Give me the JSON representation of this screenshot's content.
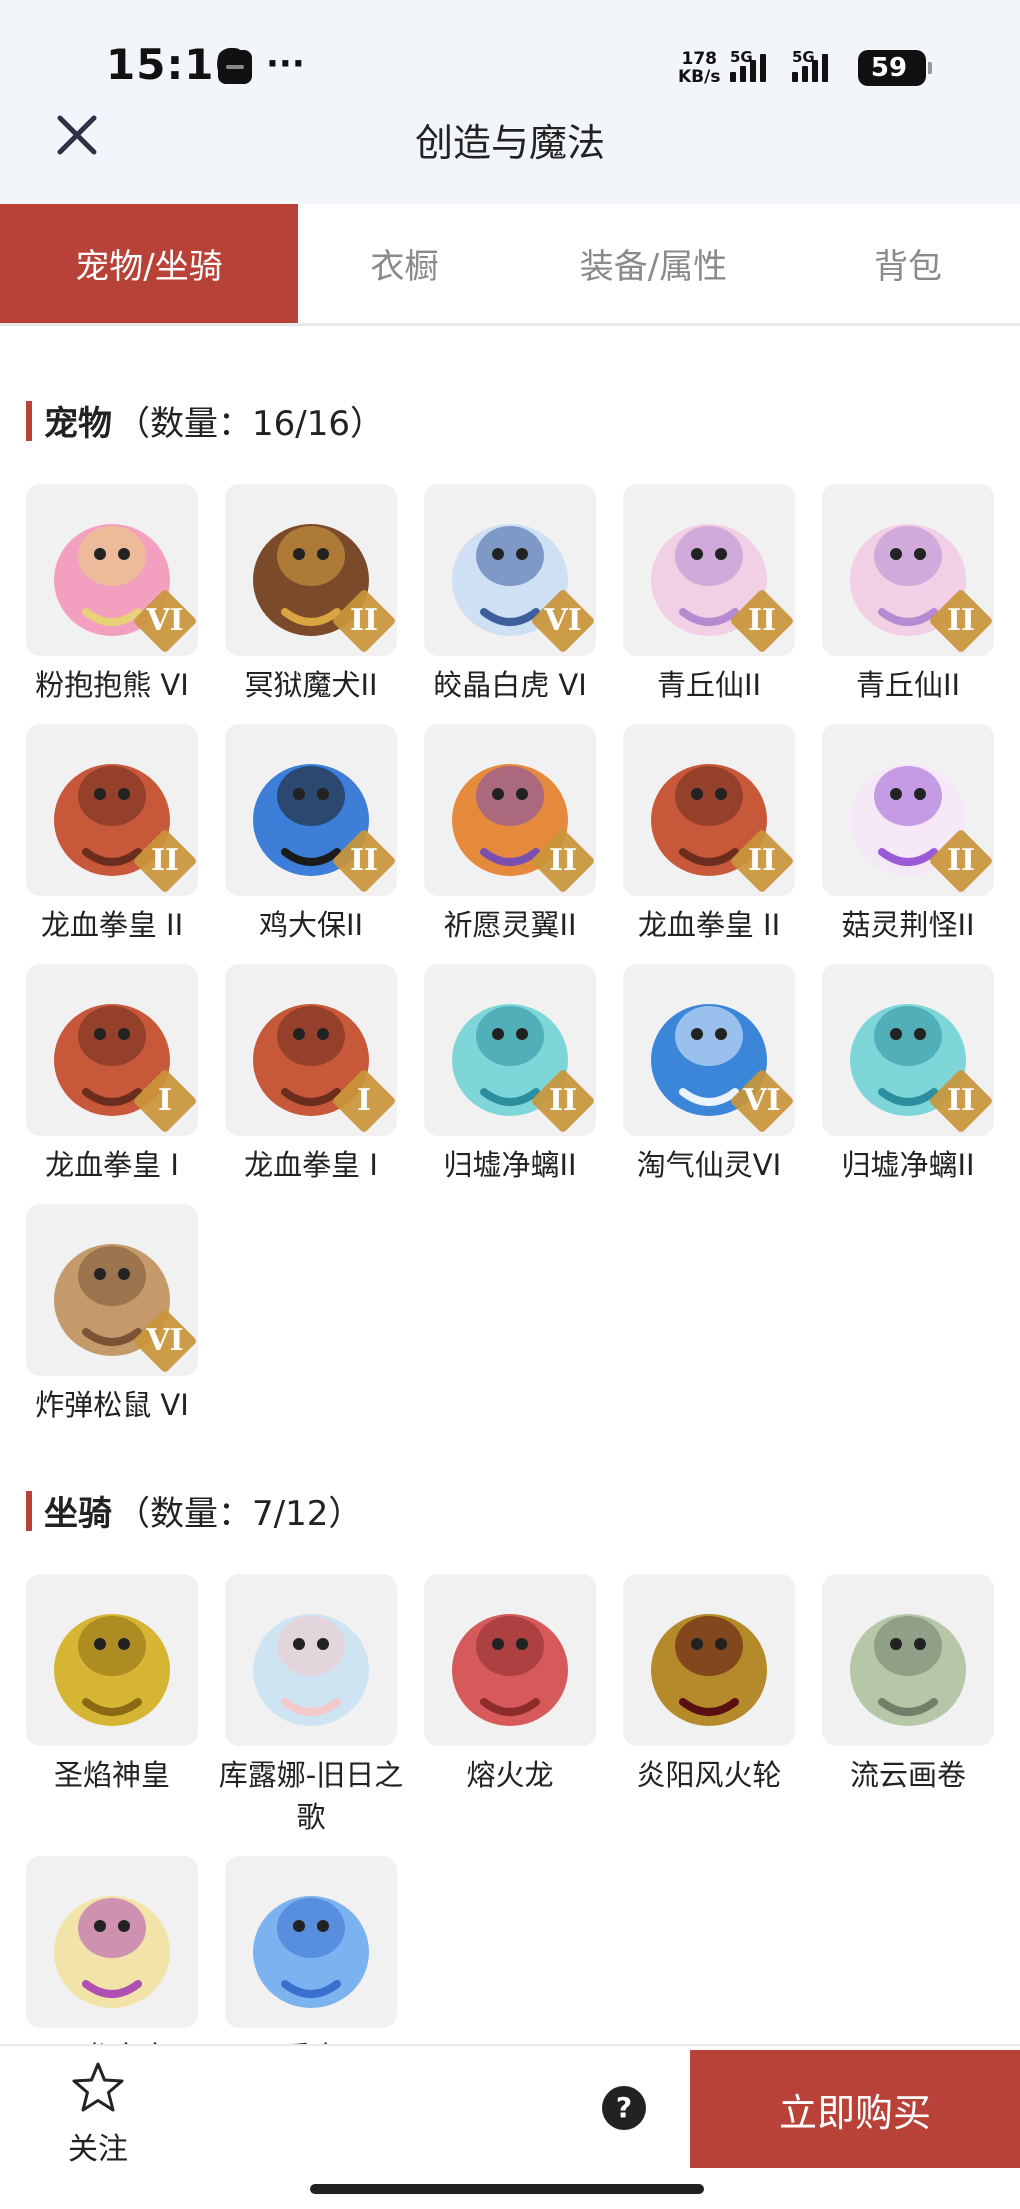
{
  "status_bar": {
    "time": "15:16",
    "net_speed_value": "178",
    "net_speed_unit": "KB/s",
    "signal_1": "5G",
    "signal_2": "5G",
    "battery": "59"
  },
  "header": {
    "title": "创造与魔法"
  },
  "tabs": [
    {
      "label": "宠物/坐骑",
      "active": true
    },
    {
      "label": "衣橱",
      "active": false
    },
    {
      "label": "装备/属性",
      "active": false
    },
    {
      "label": "背包",
      "active": false
    }
  ],
  "pets_section": {
    "title": "宠物",
    "count": "（数量：16/16）",
    "items": [
      {
        "name": "粉抱抱熊 VI",
        "icon": "pink-bear-icon",
        "badge": "VI"
      },
      {
        "name": "冥狱魔犬II",
        "icon": "hell-dog-icon",
        "badge": "II"
      },
      {
        "name": "皎晶白虎 VI",
        "icon": "white-tiger-icon",
        "badge": "VI"
      },
      {
        "name": "青丘仙II",
        "icon": "fox-fairy-icon",
        "badge": "II"
      },
      {
        "name": "青丘仙II",
        "icon": "fox-fairy-icon",
        "badge": "II"
      },
      {
        "name": "龙血拳皇 II",
        "icon": "dragon-boxer-icon",
        "badge": "II"
      },
      {
        "name": "鸡大保II",
        "icon": "blue-bird-icon",
        "badge": "II"
      },
      {
        "name": "祈愿灵翼II",
        "icon": "spirit-eagle-icon",
        "badge": "II"
      },
      {
        "name": "龙血拳皇 II",
        "icon": "dragon-boxer-icon",
        "badge": "II"
      },
      {
        "name": "菇灵荆怪II",
        "icon": "mushroom-sprite-icon",
        "badge": "II"
      },
      {
        "name": "龙血拳皇 I",
        "icon": "dragon-boxer-icon",
        "badge": "I"
      },
      {
        "name": "龙血拳皇 I",
        "icon": "dragon-boxer-icon",
        "badge": "I"
      },
      {
        "name": "归墟净螭II",
        "icon": "cyan-dragon-icon",
        "badge": "II"
      },
      {
        "name": "淘气仙灵VI",
        "icon": "blue-puppy-icon",
        "badge": "VI"
      },
      {
        "name": "归墟净螭II",
        "icon": "cyan-dragon-icon",
        "badge": "II"
      },
      {
        "name": "炸弹松鼠 VI",
        "icon": "bomb-squirrel-icon",
        "badge": "VI"
      }
    ]
  },
  "mounts_section": {
    "title": "坐骑",
    "count": "（数量：7/12）",
    "items": [
      {
        "name": "圣焰神皇",
        "icon": "golden-phoenix-icon"
      },
      {
        "name": "库露娜-旧日之歌",
        "icon": "cloud-girl-icon"
      },
      {
        "name": "熔火龙",
        "icon": "red-dragon-icon"
      },
      {
        "name": "炎阳风火轮",
        "icon": "fire-wheel-icon"
      },
      {
        "name": "流云画卷",
        "icon": "scroll-painting-icon"
      },
      {
        "name": "云龙宝宝",
        "icon": "baby-dragon-icon"
      },
      {
        "name": "可爱水母",
        "icon": "jellyfish-icon"
      }
    ]
  },
  "bottom_bar": {
    "follow_label": "关注",
    "help_label": "?",
    "buy_label": "立即购买"
  },
  "colors": {
    "accent": "#b84138",
    "header_bg": "#f2f5f9",
    "badge": "#c9953a"
  }
}
